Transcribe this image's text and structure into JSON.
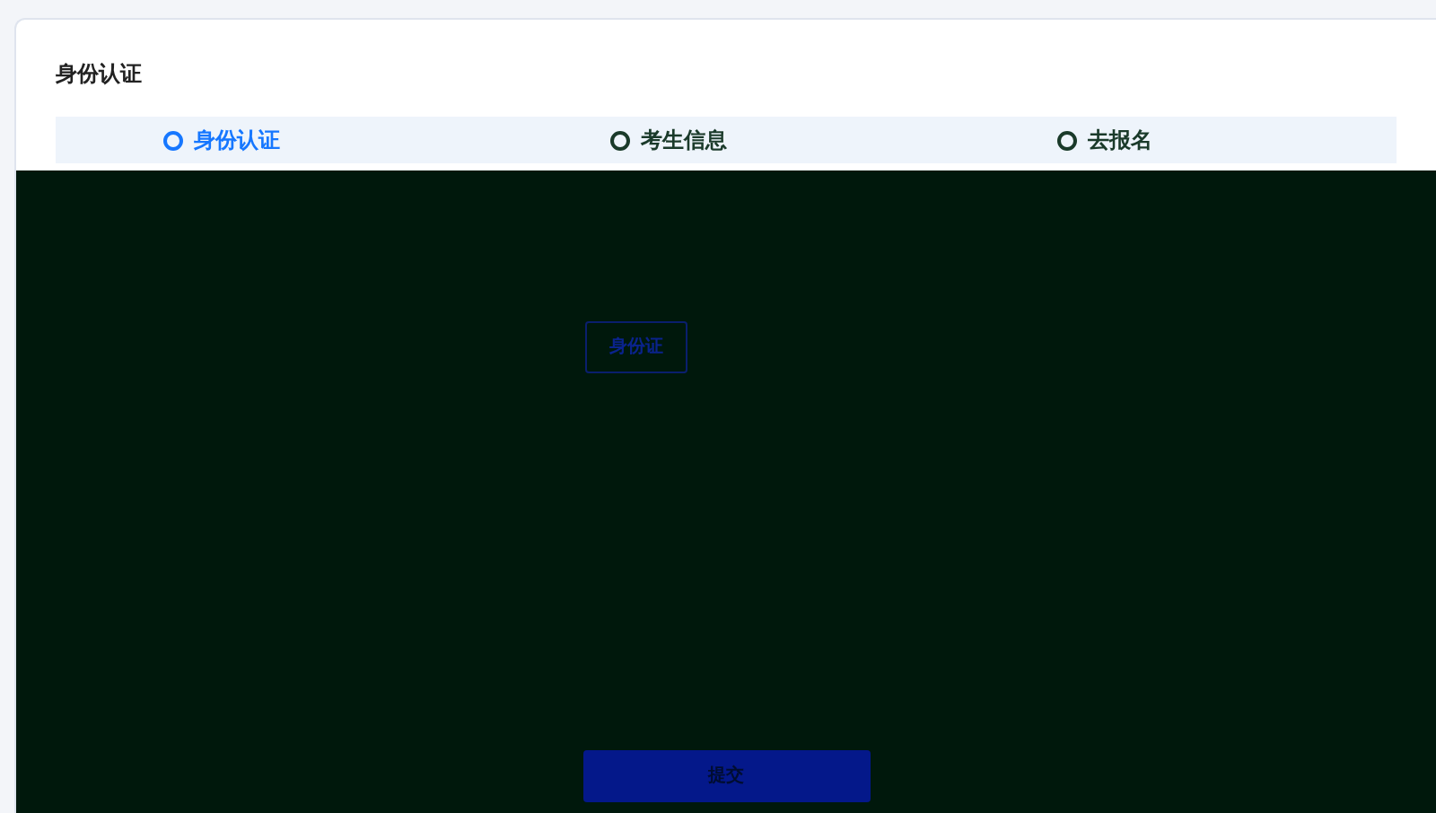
{
  "page": {
    "title": "身份认证"
  },
  "steps": [
    {
      "label": "身份认证",
      "selected": true
    },
    {
      "label": "考生信息",
      "selected": false
    },
    {
      "label": "去报名",
      "selected": false
    }
  ],
  "id_type_button": "身份证",
  "submit_button": "提交"
}
